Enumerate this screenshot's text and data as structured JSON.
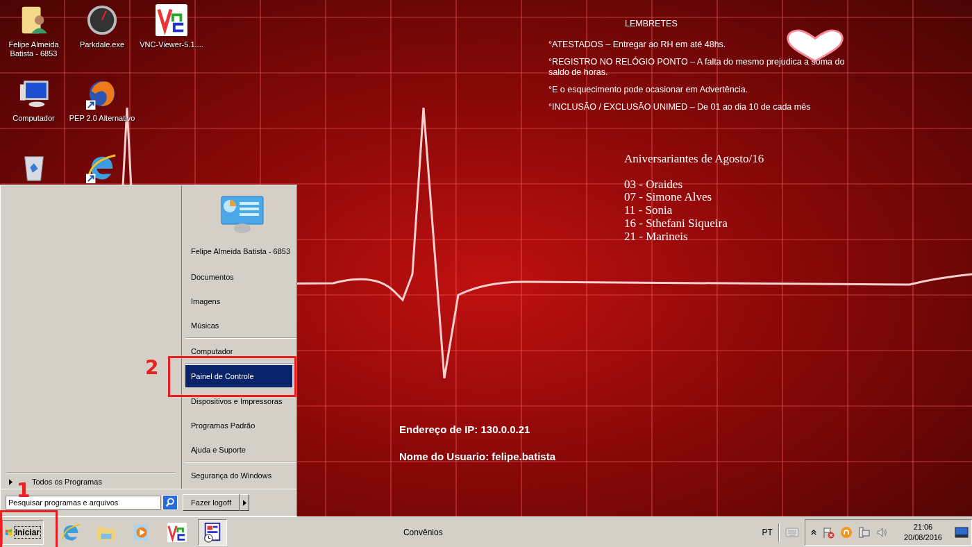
{
  "desktop_icons": [
    {
      "kind": "user-folder",
      "label": "Felipe Almeida Batista - 6853"
    },
    {
      "kind": "speedometer",
      "label": "Parkdale.exe"
    },
    {
      "kind": "vnc",
      "label": "VNC-Viewer-5.1...."
    },
    {
      "kind": "computer",
      "label": "Computador"
    },
    {
      "kind": "firefox",
      "label": "PEP 2.0 Alternativo",
      "shortcut": true
    },
    {
      "kind": "blank"
    },
    {
      "kind": "recycle-bin"
    },
    {
      "kind": "ie",
      "shortcut": true
    }
  ],
  "reminders": {
    "title": "LEMBRETES",
    "items": [
      "°ATESTADOS – Entregar ao RH em até 48hs.",
      "°REGISTRO NO RELÓGIO PONTO – A falta do mesmo prejudica a soma do saldo de horas.",
      "°E o esquecimento pode ocasionar em Advertência.",
      "°INCLUSÃO / EXCLUSÃO UNIMED –  De 01 ao dia 10 de cada mês"
    ]
  },
  "birthdays": {
    "title": "Aniversariantes de Agosto/16",
    "entries": [
      "03 - Oraides",
      "07 - Simone Alves",
      "11 - Sonia",
      "16 - Sthefani Siqueira",
      "21 - Marineis"
    ]
  },
  "network_info": [
    "Endereço de IP:  130.0.0.21",
    "Nome do Usuario: felipe.batista"
  ],
  "start_menu": {
    "user_name": "Felipe Almeida Batista - 6853",
    "items": [
      {
        "label": "Documentos",
        "selected": false,
        "separator_before": false
      },
      {
        "label": "Imagens",
        "selected": false,
        "separator_before": false
      },
      {
        "label": "Músicas",
        "selected": false,
        "separator_before": false
      },
      {
        "label": "Computador",
        "selected": false,
        "separator_before": true
      },
      {
        "label": "Painel de Controle",
        "selected": true,
        "separator_before": true
      },
      {
        "label": "Dispositivos e Impressoras",
        "selected": false,
        "separator_before": false
      },
      {
        "label": "Programas Padrão",
        "selected": false,
        "separator_before": false
      },
      {
        "label": "Ajuda e Suporte",
        "selected": false,
        "separator_before": false
      },
      {
        "label": "Segurança do Windows",
        "selected": false,
        "separator_before": true
      }
    ],
    "all_programs": "Todos os Programas",
    "search_placeholder": "Pesquisar programas e arquivos",
    "logoff": "Fazer logoff"
  },
  "annotations": [
    "1",
    "2"
  ],
  "taskbar": {
    "start_label": "Iniciar",
    "pinned": [
      {
        "kind": "ie"
      },
      {
        "kind": "folder"
      },
      {
        "kind": "media"
      },
      {
        "kind": "vnc"
      },
      {
        "kind": "schedule"
      }
    ],
    "title": "Convênios",
    "language": "PT",
    "time": "21:06",
    "date": "20/08/2016"
  }
}
